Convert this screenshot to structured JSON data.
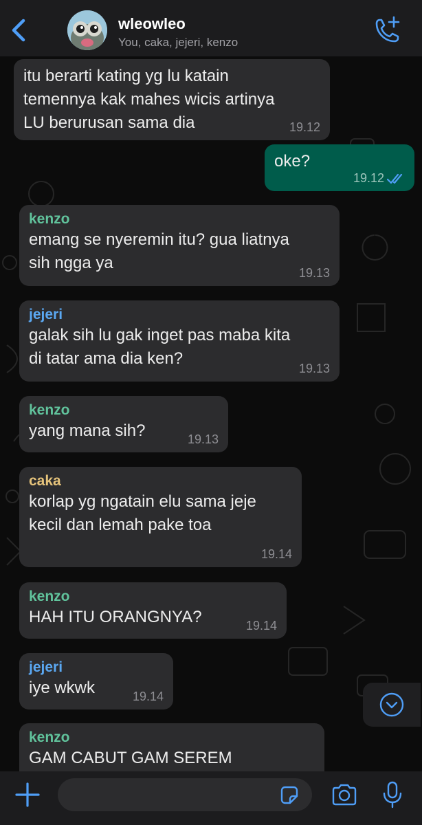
{
  "header": {
    "back_icon": "chevron-left-icon",
    "title": "wleowleo",
    "subtitle": "You, caka, jejeri, kenzo",
    "call_icon": "phone-plus-icon"
  },
  "colors": {
    "accent": "#4f9ef7",
    "kenzo": "#61c39c",
    "jejeri": "#5ba8f2",
    "caka": "#e5c37b",
    "outgoing_bubble": "#005c4b",
    "incoming_bubble": "#2c2c2e"
  },
  "messages": [
    {
      "sender": "",
      "text": "itu berarti kating yg lu katain\ntemennya kak mahes wicis artinya\nLU berurusan sama dia",
      "time": "19.12",
      "outgoing": false
    },
    {
      "sender": "",
      "text": "oke?",
      "time": "19.12",
      "outgoing": true,
      "status_icon": "double-check-read-icon"
    },
    {
      "sender": "kenzo",
      "text": "emang se nyeremin itu? gua liatnya\nsih ngga ya",
      "time": "19.13",
      "outgoing": false
    },
    {
      "sender": "jejeri",
      "text": "galak sih lu gak inget pas maba kita\ndi tatar ama dia ken?",
      "time": "19.13",
      "outgoing": false
    },
    {
      "sender": "kenzo",
      "text": "yang mana sih?",
      "time": "19.13",
      "outgoing": false
    },
    {
      "sender": "caka",
      "text": "korlap yg ngatain elu sama jeje\nkecil dan lemah pake toa",
      "time": "19.14",
      "outgoing": false
    },
    {
      "sender": "kenzo",
      "text": "HAH ITU ORANGNYA?",
      "time": "19.14",
      "outgoing": false
    },
    {
      "sender": "jejeri",
      "text": "iye wkwk",
      "time": "19.14",
      "outgoing": false
    },
    {
      "sender": "kenzo",
      "text": "GAM CABUT GAM SEREM",
      "time": "",
      "outgoing": false
    }
  ],
  "scroll_icon": "chevron-down-circle-icon",
  "composer": {
    "plus_icon": "plus-icon",
    "input_value": "",
    "sticker_icon": "sticker-icon",
    "camera_icon": "camera-icon",
    "mic_icon": "microphone-icon"
  }
}
